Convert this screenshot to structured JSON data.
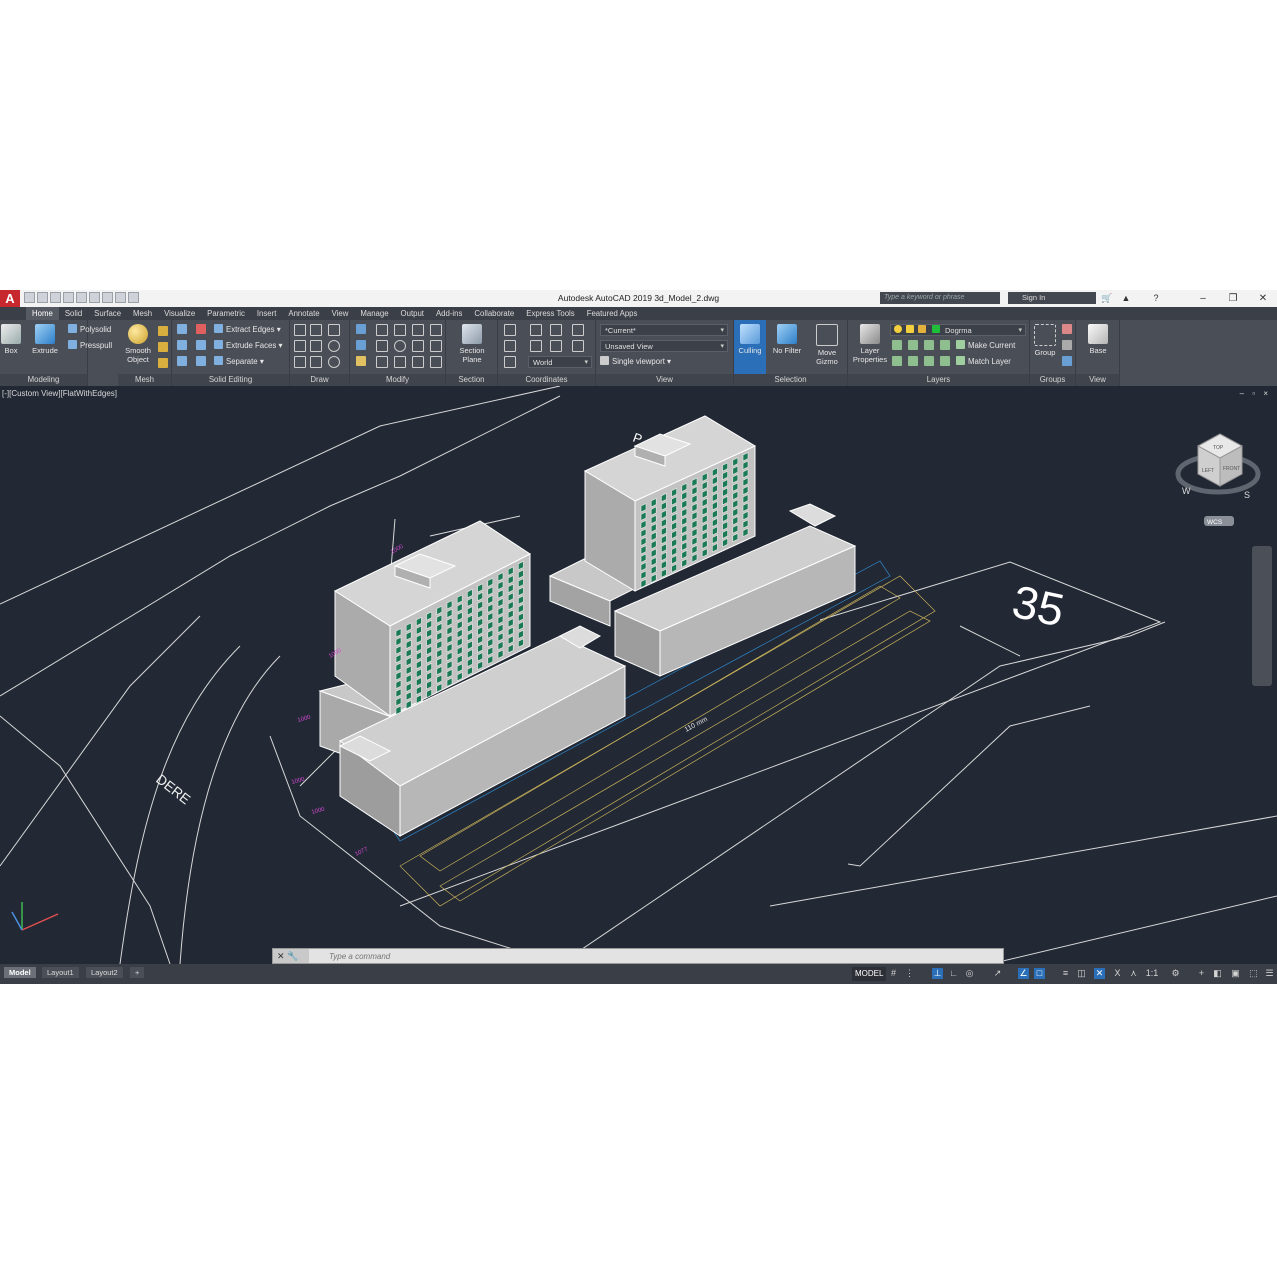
{
  "window": {
    "title": "Autodesk AutoCAD 2019   3d_Model_2.dwg",
    "app_menu": "A",
    "search_placeholder": "Type a keyword or phrase",
    "sign_in": "Sign In"
  },
  "ribbon": {
    "tabs": [
      "Home",
      "Solid",
      "Surface",
      "Mesh",
      "Visualize",
      "Parametric",
      "Insert",
      "Annotate",
      "View",
      "Manage",
      "Output",
      "Add-ins",
      "Collaborate",
      "Express Tools",
      "Featured Apps"
    ],
    "active_tab": "Home",
    "modeling": {
      "label": "Modeling",
      "box": "Box",
      "extrude": "Extrude",
      "polysolid": "Polysolid",
      "presspull": "Presspull"
    },
    "mesh": {
      "label": "Mesh",
      "smooth": "Smooth",
      "object": "Object"
    },
    "solid_editing": {
      "label": "Solid Editing",
      "extract_edges": "Extract Edges",
      "extrude_faces": "Extrude Faces",
      "separate": "Separate"
    },
    "draw": {
      "label": "Draw"
    },
    "modify": {
      "label": "Modify"
    },
    "section": {
      "label": "Section",
      "section": "Section",
      "plane": "Plane"
    },
    "coordinates": {
      "label": "Coordinates",
      "world": "World"
    },
    "view": {
      "label": "View",
      "current": "*Current*",
      "unsaved_view": "Unsaved View",
      "single_viewport": "Single viewport"
    },
    "selection": {
      "label": "Selection",
      "culling": "Culling",
      "no_filter": "No Filter",
      "move": "Move",
      "gizmo": "Gizmo"
    },
    "layers": {
      "label": "Layers",
      "layer": "Layer",
      "properties": "Properties",
      "current_layer": "Dogrma",
      "make_current": "Make Current",
      "match_layer": "Match Layer"
    },
    "groups": {
      "label": "Groups",
      "group": "Group"
    },
    "view2": {
      "label": "View",
      "base": "Base"
    }
  },
  "viewport": {
    "label": "[-][Custom View][FlatWithEdges]",
    "controls": "– ▫ ×",
    "annotations": {
      "dere": "DERE",
      "number": "35",
      "width_label": "110 mm",
      "dims": [
        "1000",
        "1000",
        "1000",
        "1000",
        "1000",
        "1077"
      ],
      "road_letter": "P"
    },
    "viewcube": {
      "top": "TOP",
      "left": "LEFT",
      "front": "FRONT",
      "w": "W",
      "s": "S",
      "wcs": "WCS"
    }
  },
  "command_line": {
    "placeholder": "Type a command"
  },
  "status_bar": {
    "layout_tabs": [
      "Model",
      "Layout1",
      "Layout2",
      "+"
    ],
    "model_button": "MODEL",
    "scale": "1:1"
  },
  "colors": {
    "viewport_bg": "#222834",
    "ribbon_bg": "#4a4e57",
    "accent": "#2a6fb8",
    "window_glass": "#1a7a55",
    "building": "#bdbdbd"
  }
}
